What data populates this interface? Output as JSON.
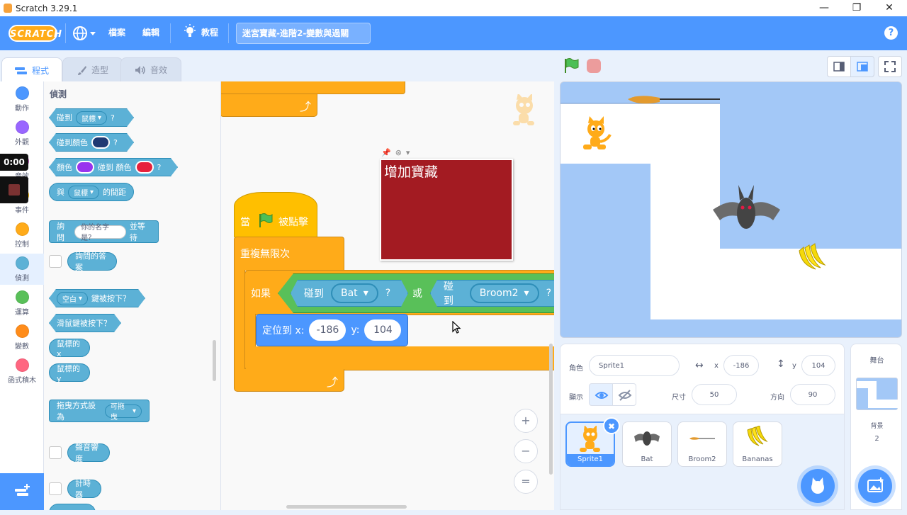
{
  "window": {
    "title": "Scratch 3.29.1",
    "minimize": "—",
    "restore": "❐",
    "close": "✕"
  },
  "menubar": {
    "logo": "SCRATCH",
    "file": "檔案",
    "edit": "編輯",
    "tutorials": "教程",
    "project_title": "迷宮寶藏-進階2-變數與過關",
    "help": "?"
  },
  "tabs": {
    "code": "程式",
    "costumes": "造型",
    "sounds": "音效"
  },
  "categories": [
    {
      "label": "動作",
      "color": "#4c97ff"
    },
    {
      "label": "外觀",
      "color": "#9966ff"
    },
    {
      "label": "音效",
      "color": "#cf63cf"
    },
    {
      "label": "事件",
      "color": "#ffbf00"
    },
    {
      "label": "控制",
      "color": "#ffab19"
    },
    {
      "label": "偵測",
      "color": "#5cb1d6"
    },
    {
      "label": "運算",
      "color": "#59c059"
    },
    {
      "label": "變數",
      "color": "#ff8c1a"
    },
    {
      "label": "函式積木",
      "color": "#ff6680"
    }
  ],
  "recorder": {
    "time": "0:00"
  },
  "palette": {
    "title": "偵測",
    "touching": "碰到",
    "mouse": "鼠標",
    "q": "?",
    "touching_color": "碰到顏色",
    "color": "顏色",
    "touching_color2": "碰到 顏色",
    "distance_prefix": "與",
    "distance_suffix": "的間距",
    "ask": "詢問",
    "ask_default": "你的名字是？",
    "ask_wait": "並等待",
    "answer": "詢問的答案",
    "key_space": "空白",
    "key_pressed": "鍵被按下？",
    "mouse_down": "滑鼠鍵被按下？",
    "mouse_x": "鼠標的 x",
    "mouse_y": "鼠標的 y",
    "drag_mode": "拖曳方式設為",
    "draggable": "可拖曳",
    "loudness": "聲音響度",
    "timer": "計時器",
    "color_swatch_1": "#1f3a73",
    "color_swatch_2": "#9933ee",
    "color_swatch_3": "#e6213c"
  },
  "workspace": {
    "when_flag": "當",
    "clicked": "被點擊",
    "forever": "重複無限次",
    "if": "如果",
    "touching": "碰到",
    "bat": "Bat",
    "or": "或",
    "broom2": "Broom2",
    "q": "?",
    "goto": "定位到 x:",
    "y_label": "y:",
    "x_val": "-186",
    "y_val": "104",
    "note": "增加寶藏",
    "zoom_in": "+",
    "zoom_out": "−",
    "zoom_reset": "="
  },
  "sprite_info": {
    "sprite_label": "角色",
    "sprite_name": "Sprite1",
    "x_label": "x",
    "x_val": "-186",
    "y_label": "y",
    "y_val": "104",
    "show_label": "顯示",
    "size_label": "尺寸",
    "size_val": "50",
    "direction_label": "方向",
    "direction_val": "90"
  },
  "sprites": [
    {
      "name": "Sprite1"
    },
    {
      "name": "Bat"
    },
    {
      "name": "Broom2"
    },
    {
      "name": "Bananas"
    }
  ],
  "stage_panel": {
    "title": "舞台",
    "backdrops_label": "背景",
    "backdrops_count": "2"
  }
}
